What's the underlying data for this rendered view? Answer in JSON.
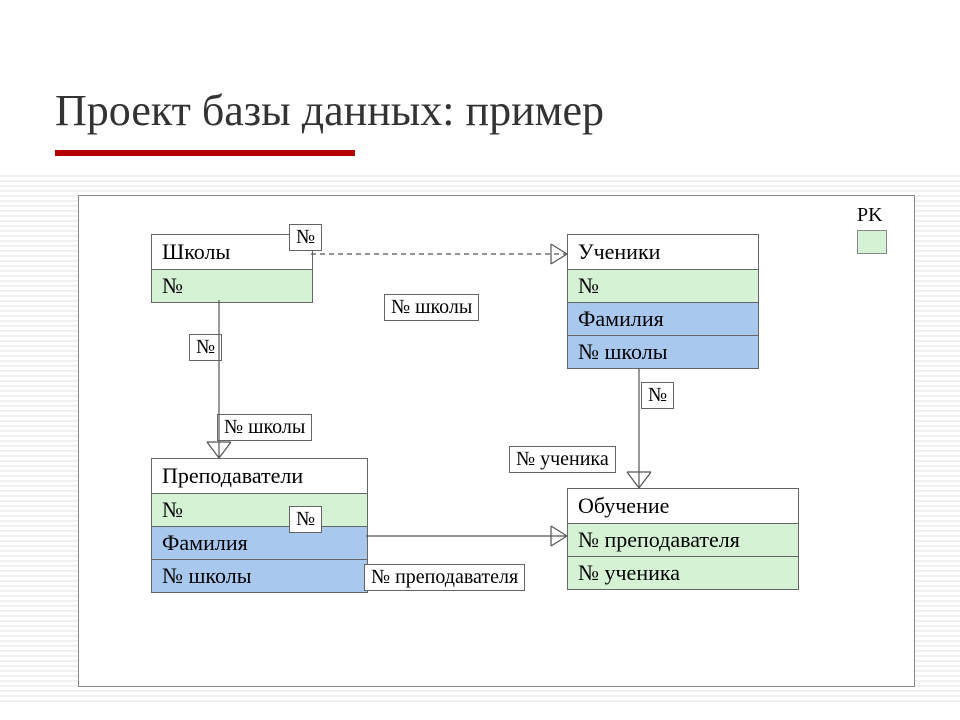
{
  "title": "Проект базы данных: пример",
  "legend": {
    "pk": "PK"
  },
  "tables": {
    "schools": {
      "title": "Школы",
      "fields": {
        "no": "№"
      }
    },
    "teachers": {
      "title": "Преподаватели",
      "fields": {
        "no": "№",
        "surname": "Фамилия",
        "school_no": "№ школы"
      }
    },
    "students": {
      "title": "Ученики",
      "fields": {
        "no": "№",
        "surname": "Фамилия",
        "school_no": "№ школы"
      }
    },
    "enrollment": {
      "title": "Обучение",
      "fields": {
        "teacher_no": "№ преподавателя",
        "student_no": "№ ученика"
      }
    }
  },
  "rel_labels": {
    "schools_to_students_parent": "№",
    "schools_to_students_child": "№ школы",
    "schools_to_teachers_parent": "№",
    "schools_to_teachers_child": "№ школы",
    "teachers_to_enrollment_parent": "№",
    "teachers_to_enrollment_child": "№ преподавателя",
    "students_to_enrollment_parent": "№",
    "students_to_enrollment_child": "№ ученика"
  }
}
